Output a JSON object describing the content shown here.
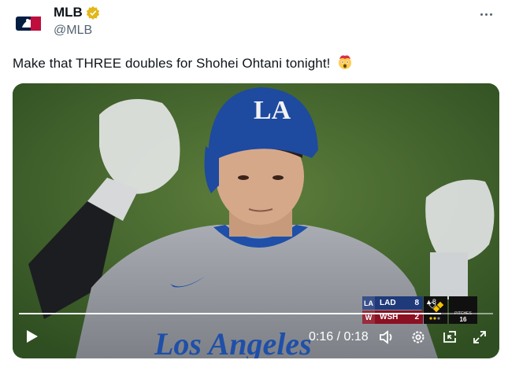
{
  "account": {
    "name": "MLB",
    "handle": "@MLB",
    "verified": true,
    "avatar_icon": "mlb-logo-icon"
  },
  "menu": {
    "icon": "more-horizontal-icon"
  },
  "tweet": {
    "text": "Make that THREE doubles for Shohei Ohtani tonight!",
    "emoji": "exploding-head-emoji"
  },
  "video": {
    "jersey_text": "Los Angeles",
    "helmet_logo": "LA",
    "scorebug": {
      "teams": [
        {
          "abbr": "LAD",
          "score": "8",
          "color": "#1f3a7a"
        },
        {
          "abbr": "WSH",
          "score": "2",
          "color": "#8a1022"
        }
      ],
      "inning": "▲8",
      "pitches_label": "PITCHES",
      "pitches": "16"
    },
    "player": {
      "current_time": "0:16",
      "duration": "0:18",
      "time_display": "0:16 / 0:18",
      "progress": 0.89,
      "play_icon": "play-icon",
      "volume_icon": "volume-icon",
      "settings_icon": "settings-gear-icon",
      "pip_icon": "picture-in-picture-icon",
      "fullscreen_icon": "fullscreen-icon"
    }
  },
  "colors": {
    "text_primary": "#0f1419",
    "text_secondary": "#536471",
    "verified_gold": "#e2b719"
  }
}
